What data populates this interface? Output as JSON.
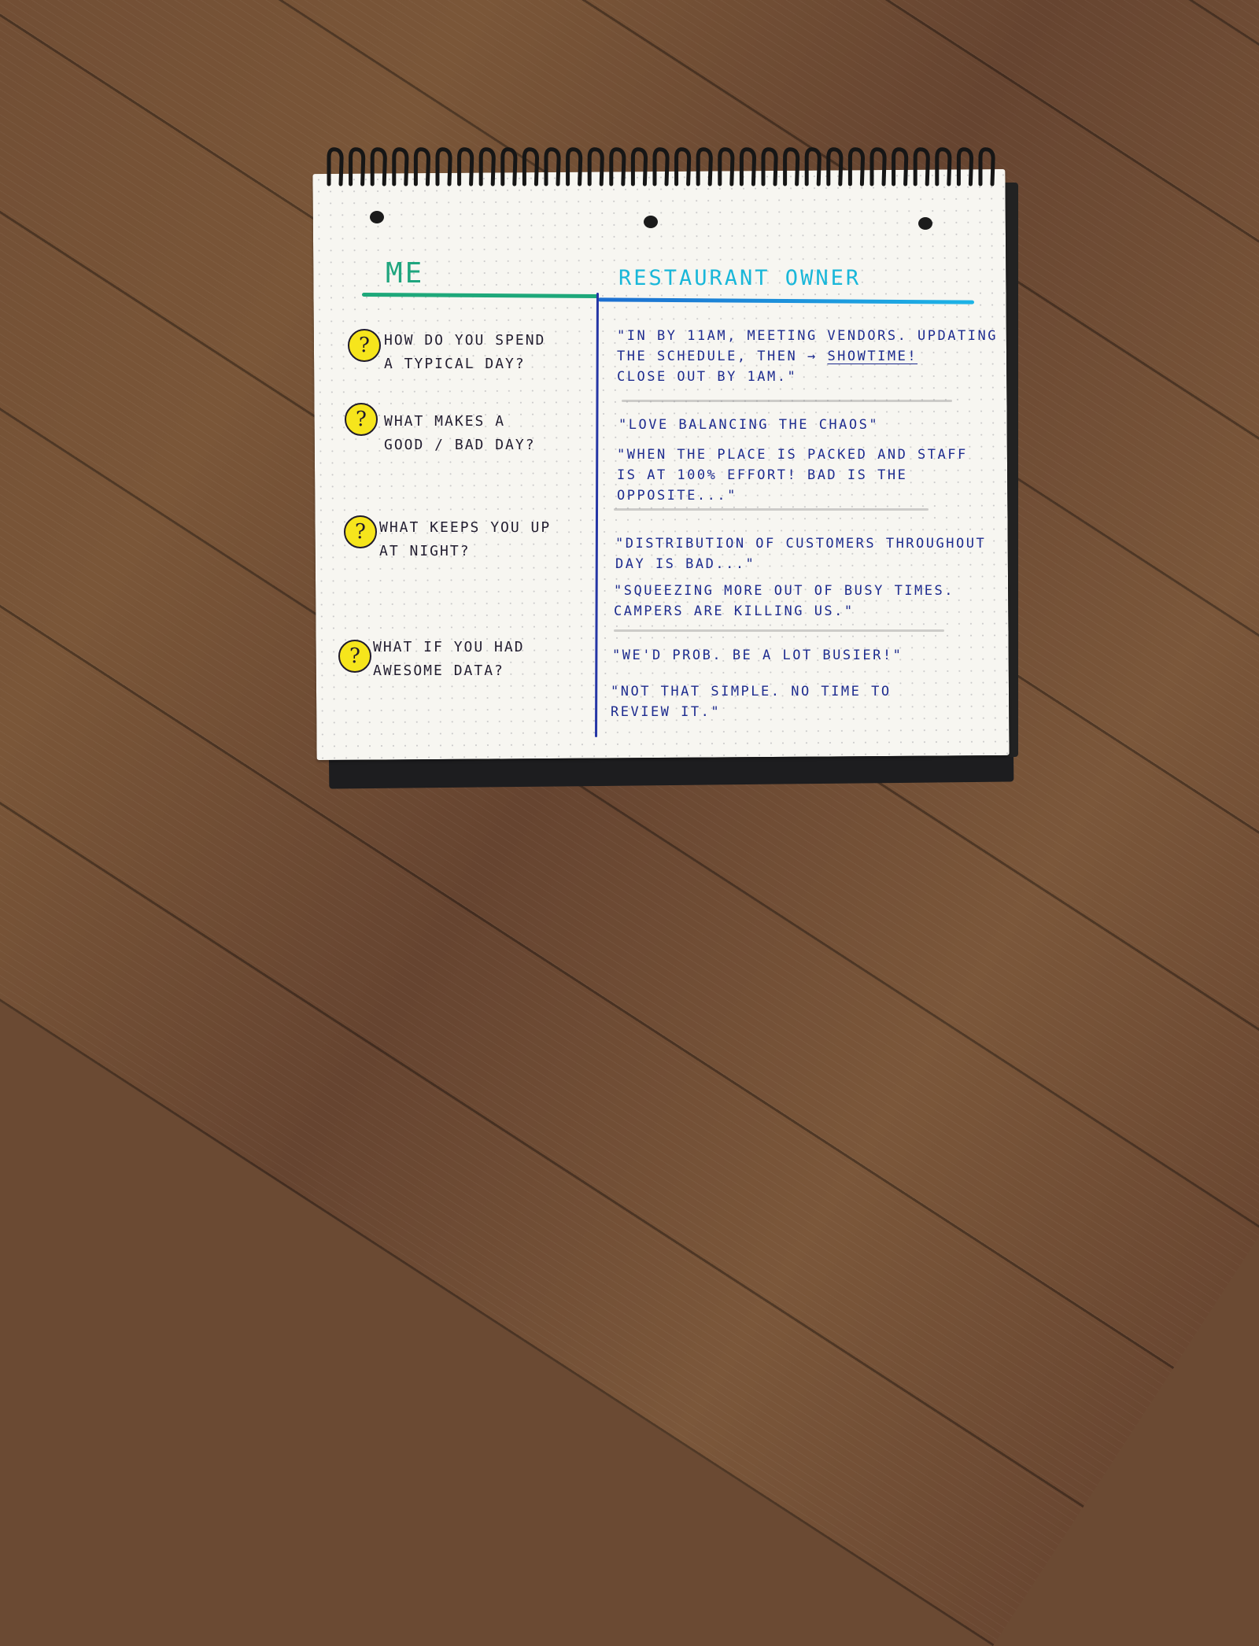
{
  "columns": {
    "left_title": "ME",
    "right_title": "RESTAURANT OWNER"
  },
  "colors": {
    "me_ink": "#1fa57e",
    "owner_ink": "#19b7d9",
    "answer_ink": "#1e2c8f",
    "question_badge": "#f6e51c"
  },
  "rows": [
    {
      "question_icon": "question-mark-icon",
      "question": [
        "HOW DO YOU SPEND",
        "A TYPICAL DAY?"
      ],
      "answers": [
        [
          "\"IN BY 11am, MEETING VENDORS. UPDATING",
          "THE SCHEDULE, THEN → SHOWTIME!",
          "CLOSE OUT BY 1am.\""
        ]
      ]
    },
    {
      "question_icon": "question-mark-icon",
      "question": [
        "WHAT MAKES A",
        "GOOD / BAD DAY?"
      ],
      "answers": [
        [
          "\"LOVE BALANCING THE CHAOS\""
        ],
        [
          "\"WHEN THE PLACE IS PACKED AND STAFF",
          "IS AT 100% EFFORT! BAD IS THE",
          "OPPOSITE...\""
        ]
      ]
    },
    {
      "question_icon": "question-mark-icon",
      "question": [
        "WHAT KEEPS YOU UP",
        "AT NIGHT?"
      ],
      "answers": [
        [
          "\"DISTRIBUTION OF CUSTOMERS THROUGHOUT",
          "DAY IS BAD...\""
        ],
        [
          "\"SQUEEZING MORE OUT OF BUSY TIMES.",
          "CAMPERS ARE KILLING US.\""
        ]
      ]
    },
    {
      "question_icon": "question-mark-icon",
      "question": [
        "WHAT IF YOU HAD",
        "AWESOME DATA?"
      ],
      "answers": [
        [
          "\"WE'D PROB. BE A LOT BUSIER!\""
        ],
        [
          "\"NOT THAT SIMPLE. NO TIME TO",
          "REVIEW IT.\""
        ]
      ]
    }
  ],
  "question_glyph": "?"
}
